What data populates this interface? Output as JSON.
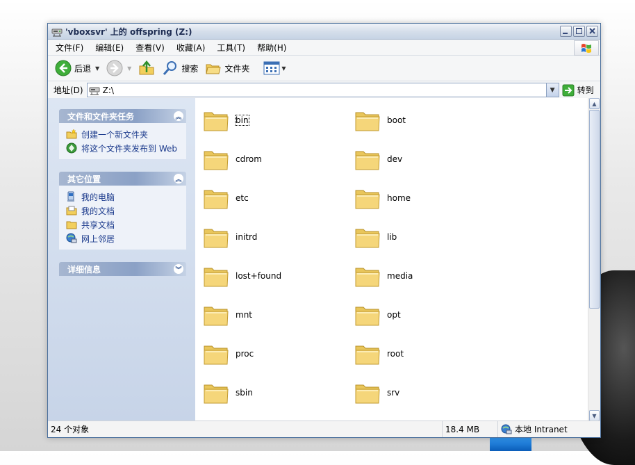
{
  "window": {
    "title": "'vboxsvr' 上的 offspring (Z:)"
  },
  "menu": [
    "文件(F)",
    "编辑(E)",
    "查看(V)",
    "收藏(A)",
    "工具(T)",
    "帮助(H)"
  ],
  "toolbar": {
    "back_label": "后退",
    "search_label": "搜索",
    "folders_label": "文件夹"
  },
  "address": {
    "label": "地址(D)",
    "value": "Z:\\",
    "go_label": "转到"
  },
  "left_panels": {
    "tasks": {
      "title": "文件和文件夹任务",
      "items": [
        "创建一个新文件夹",
        "将这个文件夹发布到 Web"
      ]
    },
    "places": {
      "title": "其它位置",
      "items": [
        "我的电脑",
        "我的文档",
        "共享文档",
        "网上邻居"
      ]
    },
    "details": {
      "title": "详细信息"
    }
  },
  "folders": [
    "bin",
    "boot",
    "cdrom",
    "dev",
    "etc",
    "home",
    "initrd",
    "lib",
    "lost+found",
    "media",
    "mnt",
    "opt",
    "proc",
    "root",
    "sbin",
    "srv"
  ],
  "status": {
    "count": "24 个对象",
    "size": "18.4 MB",
    "zone": "本地 Intranet"
  },
  "colors": {
    "link": "#1b3a8c",
    "folder": "#f5d67a"
  }
}
